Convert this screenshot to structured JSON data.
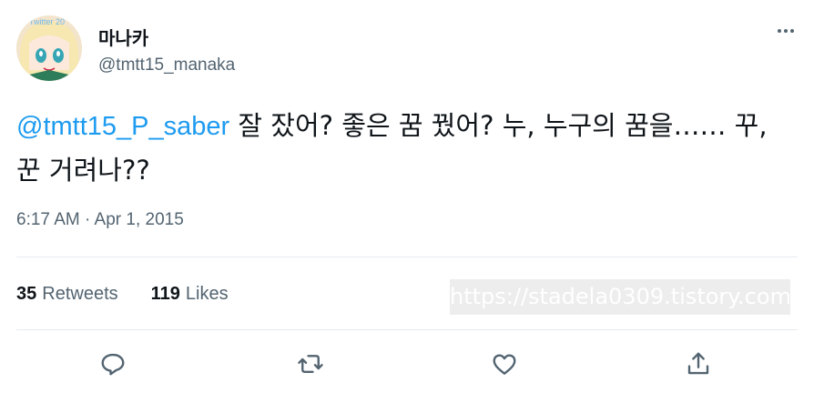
{
  "author": {
    "display_name": "마나카",
    "handle": "@tmtt15_manaka",
    "avatar_badge": "Twitter 20"
  },
  "tweet": {
    "mention": "@tmtt15_P_saber",
    "text": " 잘 잤어? 좋은 꿈 꿨어? 누, 누구의 꿈을…… 꾸, 꾼 거려나??",
    "timestamp": "6:17 AM · Apr 1, 2015"
  },
  "stats": {
    "retweets_count": "35",
    "retweets_label": "Retweets",
    "likes_count": "119",
    "likes_label": "Likes"
  },
  "watermark": "https://stadela0309.tistory.com",
  "actions": [
    "reply-icon",
    "retweet-icon",
    "like-icon",
    "share-icon"
  ],
  "colors": {
    "accent": "#1d9bf0",
    "secondary_text": "#536471",
    "divider": "#e6ecf0"
  }
}
